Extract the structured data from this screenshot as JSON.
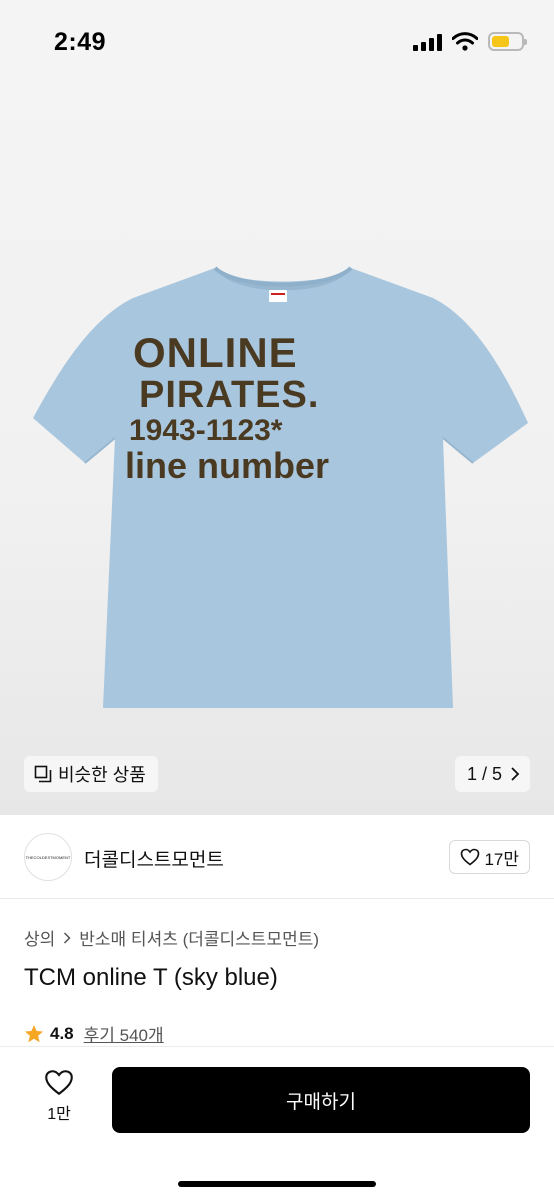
{
  "status": {
    "time": "2:49"
  },
  "product_image": {
    "print_lines": [
      "ONLINE",
      "PIRATES.",
      "1943-1123*",
      "line number"
    ],
    "shirt_color": "#a8c6de",
    "print_color": "#4a3a22"
  },
  "image_controls": {
    "similar_label": "비슷한 상품",
    "pager": "1 / 5"
  },
  "shop": {
    "name": "더콜디스트모먼트",
    "logo_text": "THECOLDESTMOMENT",
    "likes": "17만"
  },
  "breadcrumb": [
    "상의",
    "반소매 티셔츠 (더콜디스트모먼트)"
  ],
  "product": {
    "title": "TCM online T (sky blue)",
    "rating": "4.8",
    "reviews": "후기 540개"
  },
  "bottom_bar": {
    "wish_count": "1만",
    "buy_label": "구매하기"
  },
  "colors": {
    "star": "#f5a623",
    "battery": "#f5c518",
    "buy_button": "#000000"
  }
}
